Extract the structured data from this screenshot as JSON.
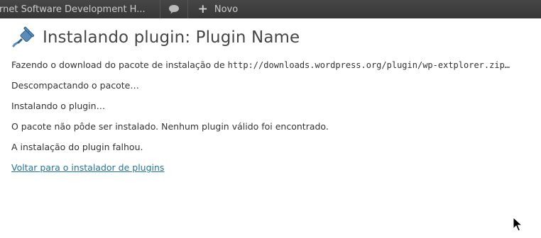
{
  "adminbar": {
    "site_name": "ernet Software Development H...",
    "new_label": "Novo"
  },
  "page": {
    "title": "Instalando plugin: Plugin Name"
  },
  "log": {
    "download_prefix": "Fazendo o download do pacote de instalação de ",
    "download_url": "http://downloads.wordpress.org/plugin/wp-extplorer.zip…",
    "unpacking": "Descompactando o pacote…",
    "installing": "Instalando o plugin…",
    "error": "O pacote não pôde ser instalado. Nenhum plugin válido foi encontrado.",
    "failed": "A instalação do plugin falhou.",
    "back_link": "Voltar para o instalador de plugins"
  }
}
